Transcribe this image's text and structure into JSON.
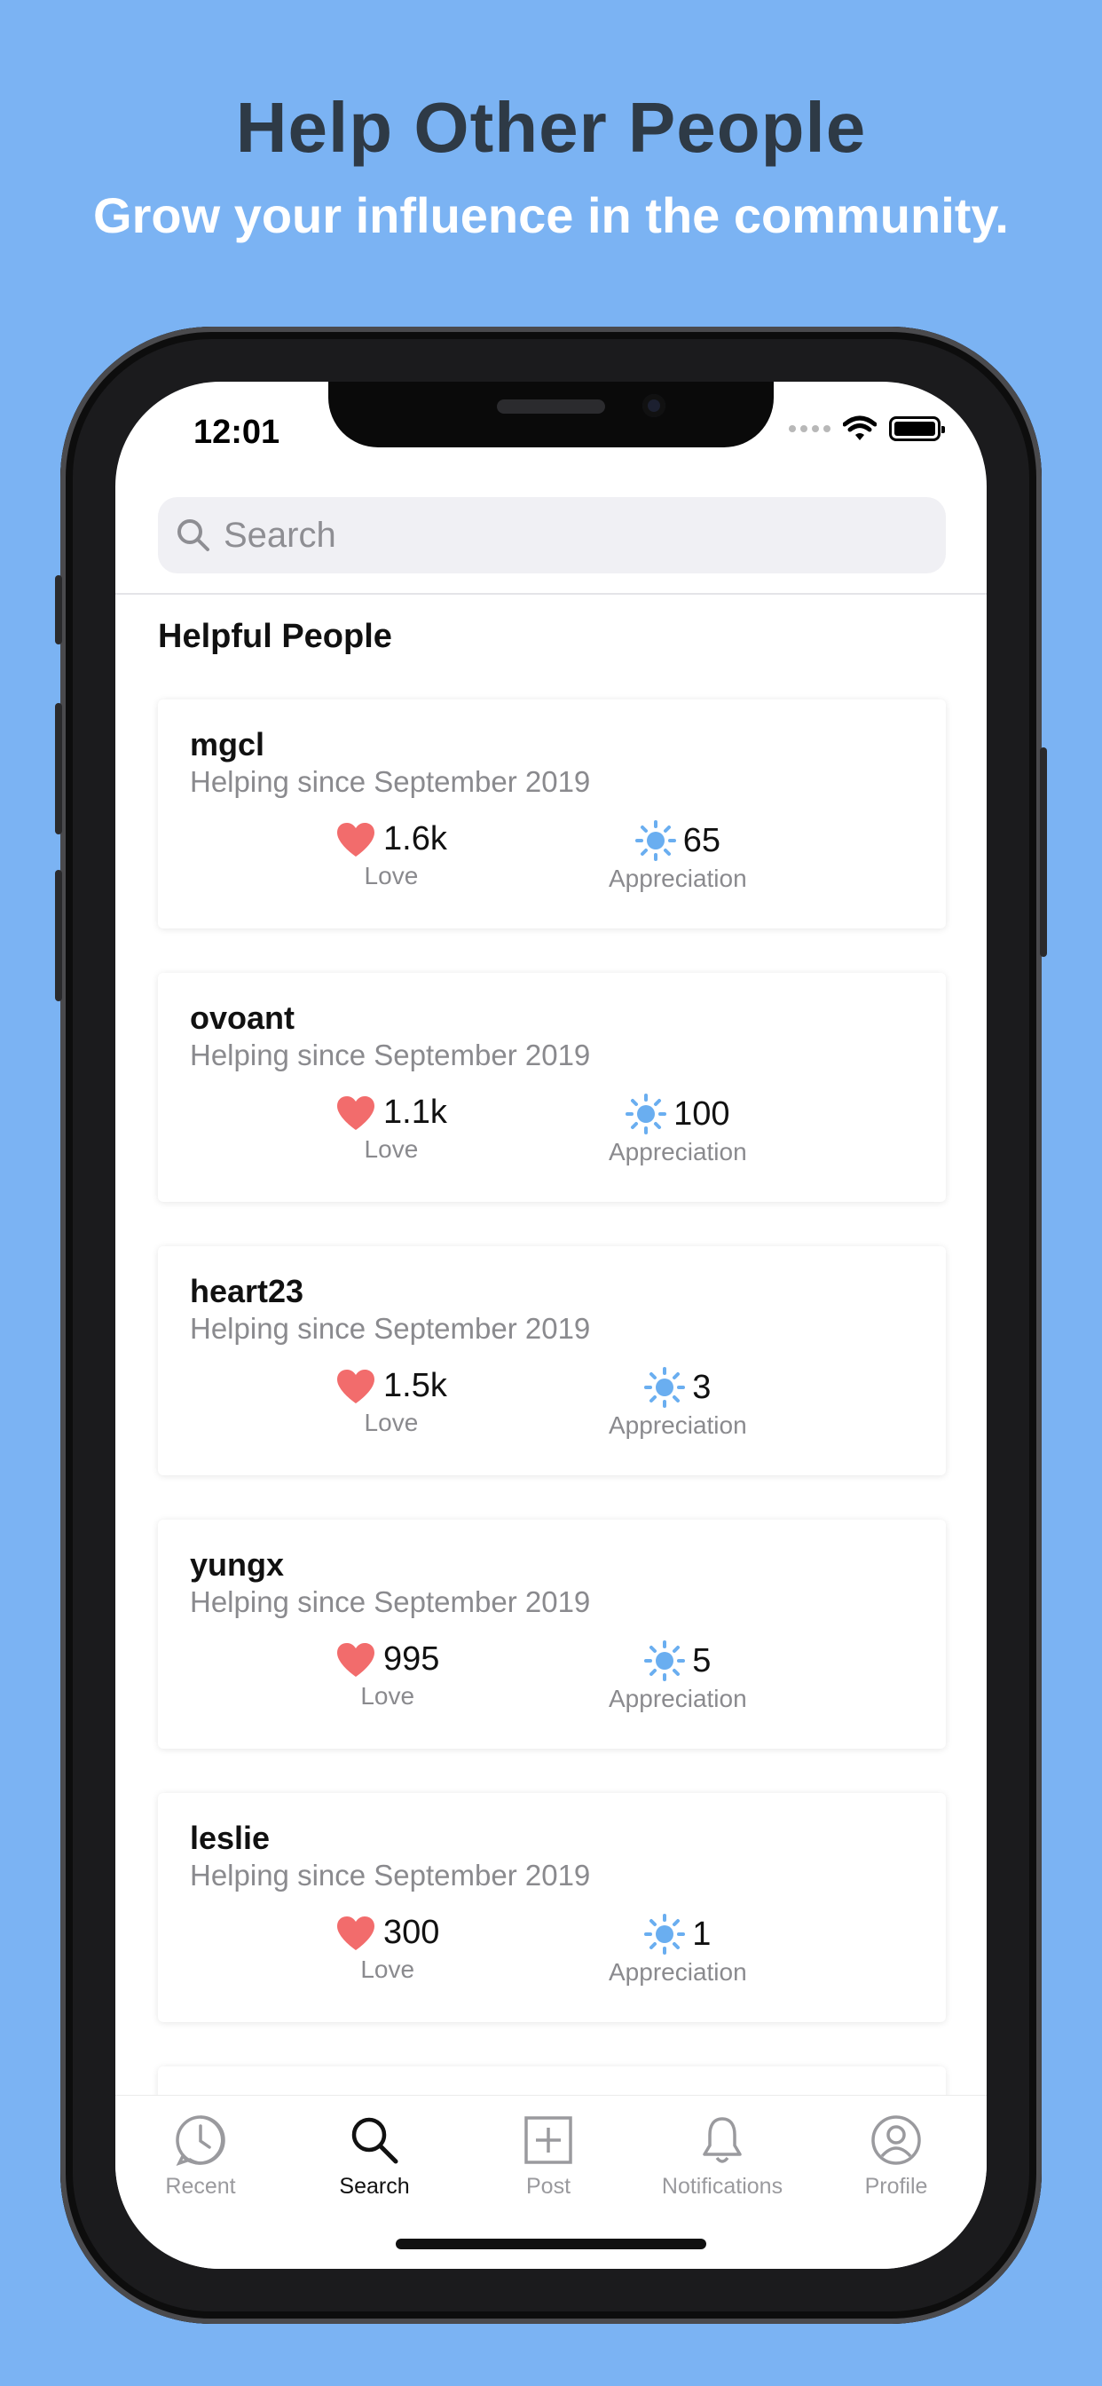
{
  "headline": "Help Other People",
  "subline": "Grow your influence in the community.",
  "status_bar": {
    "time": "12:01"
  },
  "search": {
    "placeholder": "Search"
  },
  "section_title": "Helpful People",
  "people": [
    {
      "username": "mgcl",
      "since": "Helping since September 2019",
      "love": "1.6k",
      "appreciation": "65"
    },
    {
      "username": "ovoant",
      "since": "Helping since September 2019",
      "love": "1.1k",
      "appreciation": "100"
    },
    {
      "username": "heart23",
      "since": "Helping since September 2019",
      "love": "1.5k",
      "appreciation": "3"
    },
    {
      "username": "yungx",
      "since": "Helping since September 2019",
      "love": "995",
      "appreciation": "5"
    },
    {
      "username": "leslie",
      "since": "Helping since September 2019",
      "love": "300",
      "appreciation": "1"
    }
  ],
  "labels": {
    "love": "Love",
    "appreciation": "Appreciation"
  },
  "tabs": [
    {
      "label": "Recent",
      "icon": "clock-bubble-icon"
    },
    {
      "label": "Search",
      "icon": "search-icon"
    },
    {
      "label": "Post",
      "icon": "plus-square-icon"
    },
    {
      "label": "Notifications",
      "icon": "bell-icon"
    },
    {
      "label": "Profile",
      "icon": "user-circle-icon"
    }
  ],
  "active_tab": "Search",
  "colors": {
    "background": "#7BB3F3",
    "headline": "#2E3A46",
    "heart": "#F26C6C",
    "sun": "#6AAEF0"
  }
}
